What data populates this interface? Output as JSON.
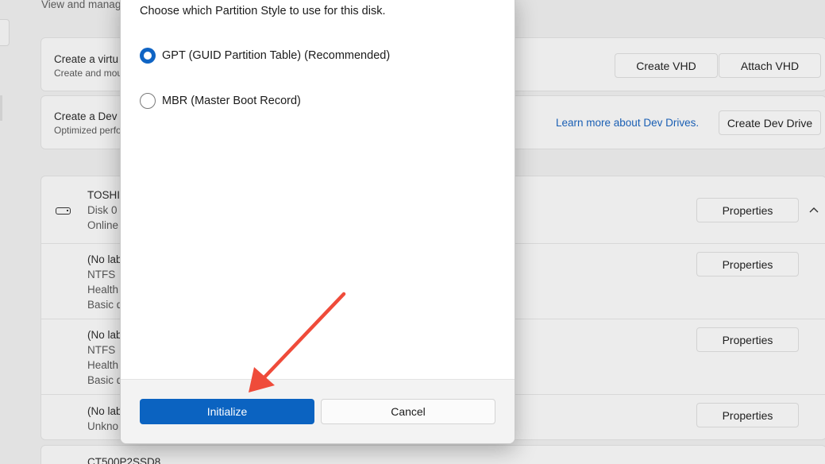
{
  "background": {
    "header_text": "View and manag",
    "vhd_card": {
      "title": "Create a virtu",
      "subtitle": "Create and mou",
      "create_label": "Create VHD",
      "attach_label": "Attach VHD"
    },
    "dev_card": {
      "title": "Create a Dev",
      "subtitle": "Optimized perfo",
      "learn_link": "Learn more about Dev Drives.",
      "create_label": "Create Dev Drive"
    },
    "disk": {
      "name": "TOSHI",
      "line2": "Disk 0",
      "line3": "Online",
      "properties_label": "Properties"
    },
    "volumes": [
      {
        "lines": [
          "(No lab",
          "NTFS",
          "Health",
          "Basic d"
        ],
        "properties_label": "Properties"
      },
      {
        "lines": [
          "(No lab",
          "NTFS",
          "Health",
          "Basic d"
        ],
        "properties_label": "Properties"
      },
      {
        "lines": [
          "(No lab",
          "Unkno"
        ],
        "properties_label": "Properties"
      }
    ],
    "bottom_disk": "CT500P2SSD8"
  },
  "dialog": {
    "instruction": "Choose which Partition Style to use for this disk.",
    "options": [
      {
        "label": "GPT (GUID Partition Table) (Recommended)",
        "selected": true
      },
      {
        "label": "MBR (Master Boot Record)",
        "selected": false
      }
    ],
    "initialize_label": "Initialize",
    "cancel_label": "Cancel"
  },
  "colors": {
    "accent": "#0b63c1",
    "link": "#1a5fb4",
    "annotation_arrow": "#ef4b3a"
  }
}
